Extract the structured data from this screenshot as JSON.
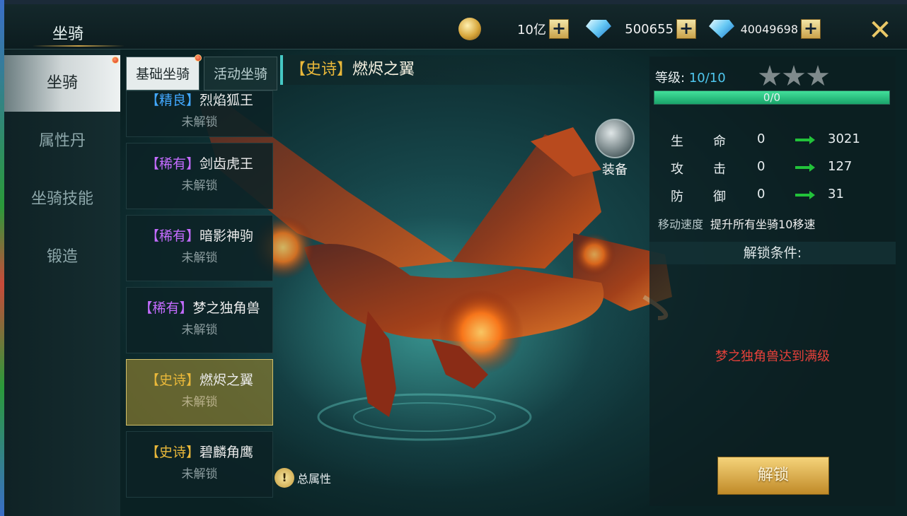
{
  "top": {
    "title": "坐骑",
    "gold": "10亿",
    "diamond": "500655",
    "bound_diamond": "40049698"
  },
  "nav": [
    {
      "label": "坐骑"
    },
    {
      "label": "属性丹"
    },
    {
      "label": "坐骑技能"
    },
    {
      "label": "锻造"
    }
  ],
  "tabs": {
    "basic": "基础坐骑",
    "event": "活动坐骑"
  },
  "mounts": [
    {
      "tag": "【精良】",
      "name": "烈焰狐王",
      "status": "未解锁"
    },
    {
      "tag": "【稀有】",
      "name": "剑齿虎王",
      "status": "未解锁"
    },
    {
      "tag": "【稀有】",
      "name": "暗影神驹",
      "status": "未解锁"
    },
    {
      "tag": "【稀有】",
      "name": "梦之独角兽",
      "status": "未解锁"
    },
    {
      "tag": "【史诗】",
      "name": "燃烬之翼",
      "status": "未解锁"
    },
    {
      "tag": "【史诗】",
      "name": "碧麟角鹰",
      "status": "未解锁"
    }
  ],
  "selected": {
    "tag": "【史诗】",
    "name": "燃烬之翼"
  },
  "equip_label": "装备",
  "total_attr_label": "总属性",
  "panel": {
    "level_label": "等级:",
    "level_value": "10/10",
    "stars_filled": 0,
    "stars_total": 3,
    "exp_text": "0/0",
    "exp_fraction": 1.0,
    "stats": [
      {
        "c1": "生",
        "c2": "命",
        "cur": "0",
        "next": "3021"
      },
      {
        "c1": "攻",
        "c2": "击",
        "cur": "0",
        "next": "127"
      },
      {
        "c1": "防",
        "c2": "御",
        "cur": "0",
        "next": "31"
      }
    ],
    "speed_label": "移动速度",
    "speed_text": "提升所有坐骑10移速",
    "unlock_header": "解锁条件:",
    "unlock_condition": "梦之独角兽达到满级",
    "unlock_button": "解锁"
  },
  "colors": {
    "epic": "#e9b83a",
    "rare": "#c46cff",
    "fine": "#42a8ff",
    "condition": "#e6413a"
  }
}
